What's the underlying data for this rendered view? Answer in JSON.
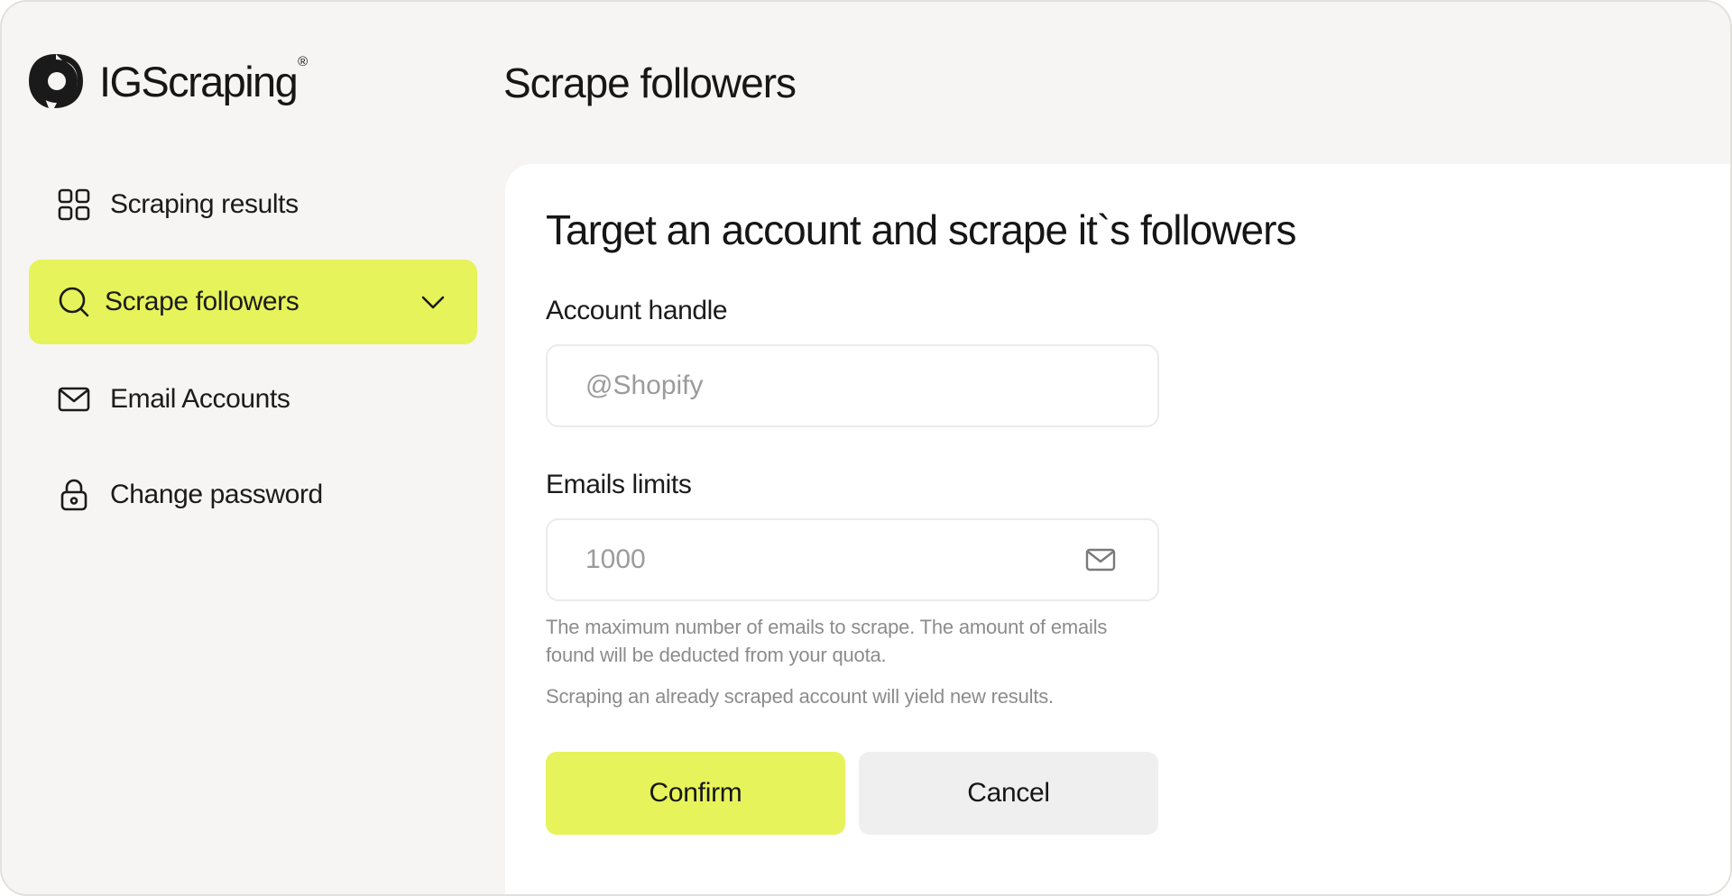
{
  "brand": {
    "name": "IGScraping",
    "registered_mark": "®"
  },
  "header": {
    "title": "Scrape followers"
  },
  "sidebar": {
    "items": [
      {
        "label": "Scraping results",
        "icon": "grid-icon",
        "active": false
      },
      {
        "label": "Scrape followers",
        "icon": "search-icon",
        "active": true,
        "expand_icon": "chevron-down-icon"
      },
      {
        "label": "Email Accounts",
        "icon": "mail-icon",
        "active": false
      },
      {
        "label": "Change password",
        "icon": "lock-icon",
        "active": false
      }
    ]
  },
  "form": {
    "heading": "Target an account and scrape it`s followers",
    "account_handle": {
      "label": "Account handle",
      "placeholder": "@Shopify",
      "value": ""
    },
    "emails_limit": {
      "label": "Emails limits",
      "placeholder": "1000",
      "value": "",
      "icon": "mail-icon"
    },
    "help_text_1": "The maximum number of emails to scrape. The amount of emails found will be deducted from your quota.",
    "help_text_2": "Scraping an already scraped account will yield new results.",
    "confirm_label": "Confirm",
    "cancel_label": "Cancel"
  },
  "colors": {
    "accent": "#e6f35a",
    "background": "#f6f5f3",
    "card": "#ffffff",
    "secondary_button": "#efefef",
    "muted_text": "#8c8c8c"
  }
}
